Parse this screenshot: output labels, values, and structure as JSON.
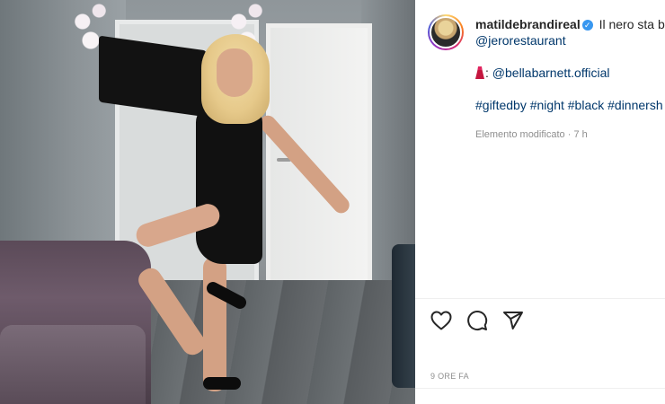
{
  "post": {
    "username": "matildebrandireal",
    "verified_glyph": "✓",
    "caption_start": "Il nero sta be",
    "mention_restaurant": "@jerorestaurant",
    "dress_icon": "dress-emoji",
    "dress_prefix": ": ",
    "mention_dress": "@bellabarnett.official",
    "hashtags": [
      "#giftedby",
      "#night",
      "#black",
      "#dinnersh"
    ],
    "edited_label": "Elemento modificato",
    "separator": "·",
    "edited_time": "7 h",
    "time_ago": "9 ORE FA"
  },
  "actions": [
    {
      "name": "like-button",
      "icon": "heart-icon"
    },
    {
      "name": "comment-button",
      "icon": "comment-icon"
    },
    {
      "name": "share-button",
      "icon": "send-icon"
    }
  ],
  "colors": {
    "link": "#00376b",
    "meta": "#8e8e8e",
    "verified": "#3897f0"
  }
}
